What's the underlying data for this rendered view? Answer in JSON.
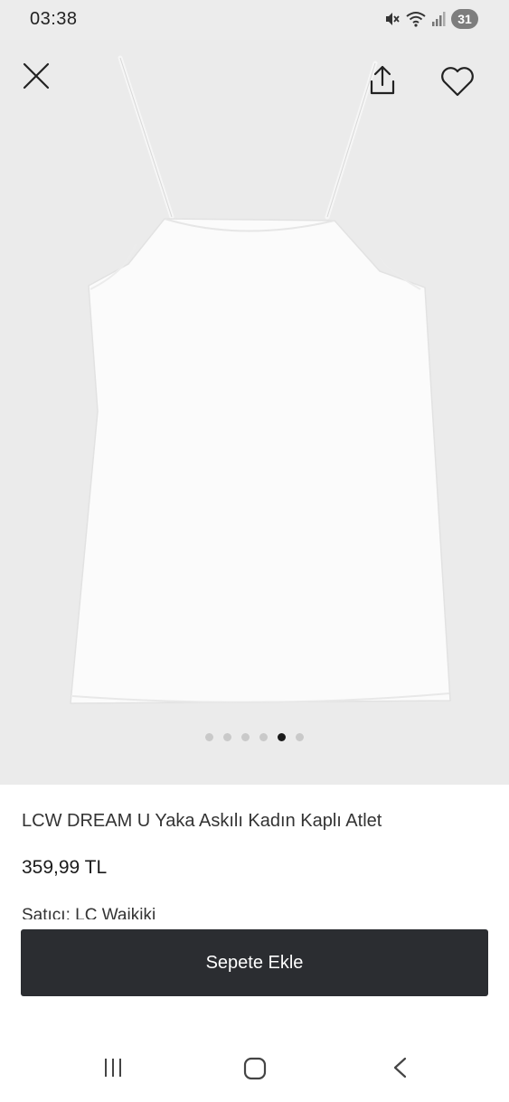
{
  "status_bar": {
    "time": "03:38",
    "battery_level": "31",
    "icons": [
      "mute-icon",
      "wifi-icon",
      "signal-icon",
      "battery-icon"
    ]
  },
  "gallery": {
    "image_count": 6,
    "active_index": 4,
    "image_subject": "white camisole",
    "background_color": "#ebebeb"
  },
  "top_actions": {
    "close_icon": "close-icon",
    "share_icon": "share-icon",
    "favorite_icon": "heart-icon"
  },
  "product": {
    "title": "LCW DREAM U Yaka Askılı Kadın Kaplı Atlet",
    "price": "359,99 TL",
    "seller_label": "Satıcı:",
    "seller_name": "LC Waikiki"
  },
  "cta": {
    "label": "Sepete Ekle",
    "color": "#2b2d31"
  },
  "nav_bar": {
    "icons": [
      "recent-apps-icon",
      "home-icon",
      "back-icon"
    ]
  }
}
